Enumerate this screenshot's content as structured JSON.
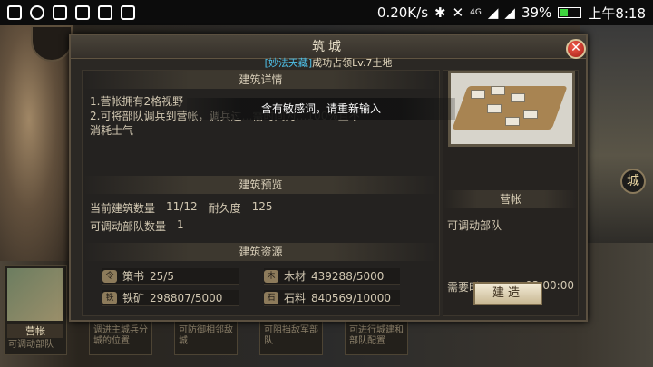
{
  "status_bar": {
    "network_speed": "0.20K/s",
    "network_type": "4G",
    "battery": "39%",
    "time": "上午8:18"
  },
  "dialog": {
    "title": "筑城",
    "subtitle_highlight": "[妙法天藏]",
    "subtitle_rest": "成功占领Lv.7土地",
    "detail_header": "建筑详情",
    "detail_line1": "1.营帐拥有2格视野",
    "detail_line2": "2.可将部队调兵到营帐，调兵过…需时间为…100%且不",
    "detail_line3": "消耗士气",
    "preview_header": "建筑预览",
    "build_count_label": "当前建筑数量",
    "build_count_value": "11/12",
    "durability_label": "耐久度",
    "durability_value": "125",
    "army_count_label": "可调动部队数量",
    "army_count_value": "1",
    "resources_header": "建筑资源",
    "resources": [
      {
        "icon": "令",
        "name": "策书",
        "value": "25/5"
      },
      {
        "icon": "木",
        "name": "木材",
        "value": "439288/5000"
      },
      {
        "icon": "铁",
        "name": "铁矿",
        "value": "298807/5000"
      },
      {
        "icon": "石",
        "name": "石料",
        "value": "840569/10000"
      }
    ],
    "building_name": "营帐",
    "building_desc": "可调动部队",
    "time_label": "需要时间",
    "time_value": "03:00:00",
    "build_button": "建造",
    "close_icon": "close-icon"
  },
  "toast": "含有敏感词，请重新输入",
  "cards": [
    {
      "name": "营帐",
      "desc": "可调动部队"
    },
    {
      "name": "",
      "desc": "调进主城兵分城的位置"
    },
    {
      "name": "",
      "desc": "可防御相邻敌城"
    },
    {
      "name": "",
      "desc": "可阻挡敌军部队"
    },
    {
      "name": "",
      "desc": "可进行城建和部队配置"
    }
  ],
  "side_icon": "城"
}
